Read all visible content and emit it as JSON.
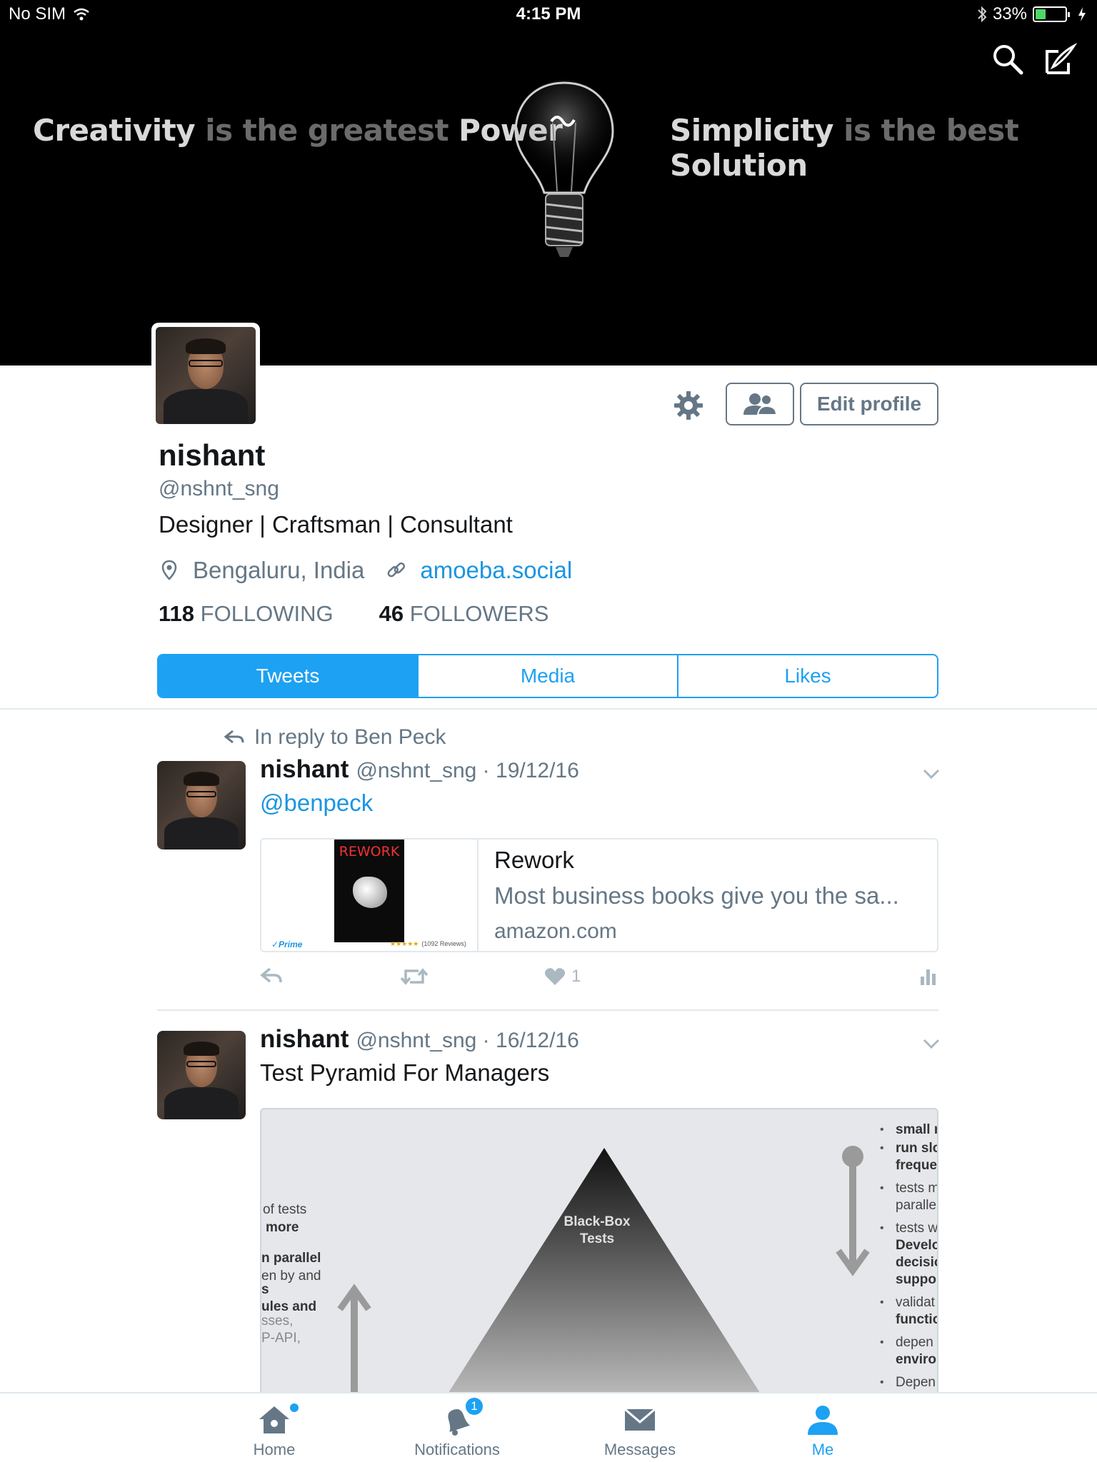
{
  "status_bar": {
    "carrier": "No SIM",
    "time": "4:15 PM",
    "battery": "33%",
    "icons": [
      "wifi-icon",
      "bluetooth-icon",
      "battery-icon",
      "charging-icon"
    ]
  },
  "banner": {
    "left_quote": {
      "w1": "Creativity",
      "w2": " is the greatest ",
      "w3": "Power"
    },
    "right_quote": {
      "w1": "Simplicity",
      "w2": " is the best ",
      "w3": "Solution"
    },
    "icons": [
      "search-icon",
      "compose-icon"
    ]
  },
  "profile": {
    "name": "nishant",
    "handle": "@nshnt_sng",
    "bio": "Designer | Craftsman | Consultant",
    "location": "Bengaluru, India",
    "website": "amoeba.social",
    "following_count": "118",
    "following_label": "FOLLOWING",
    "followers_count": "46",
    "followers_label": "FOLLOWERS",
    "edit_profile_label": "Edit profile"
  },
  "tabs": [
    "Tweets",
    "Media",
    "Likes"
  ],
  "tweets": [
    {
      "reply_context": "In reply to Ben Peck",
      "name": "nishant",
      "handle_date": "@nshnt_sng · 19/12/16",
      "text": "@benpeck",
      "card": {
        "title": "Rework",
        "description": "Most business books give you the sa...",
        "domain": "amazon.com",
        "book_title": "REWORK",
        "prime": "✓Prime",
        "stars": "★★★★★",
        "reviews": "(1092 Reviews)"
      },
      "like_count": "1"
    },
    {
      "name": "nishant",
      "handle_date": "@nshnt_sng · 16/12/16",
      "text": "Test Pyramid For Managers",
      "image": {
        "center_label_1": "Black-Box",
        "center_label_2": "Tests",
        "left_lines": [
          "of tests",
          "more",
          "n parallel",
          "en by and",
          "s",
          "ules and",
          "sses,",
          "P-API,"
        ],
        "right_lines": [
          "small r",
          "run slo",
          "freque",
          "tests m",
          "paralle",
          "tests w",
          "Develo",
          "decisio",
          "suppor",
          "validat",
          "functio",
          "depen",
          "enviro",
          "Depen"
        ]
      }
    }
  ],
  "tab_bar": {
    "home": "Home",
    "notifications": "Notifications",
    "notifications_badge": "1",
    "messages": "Messages",
    "me": "Me"
  }
}
